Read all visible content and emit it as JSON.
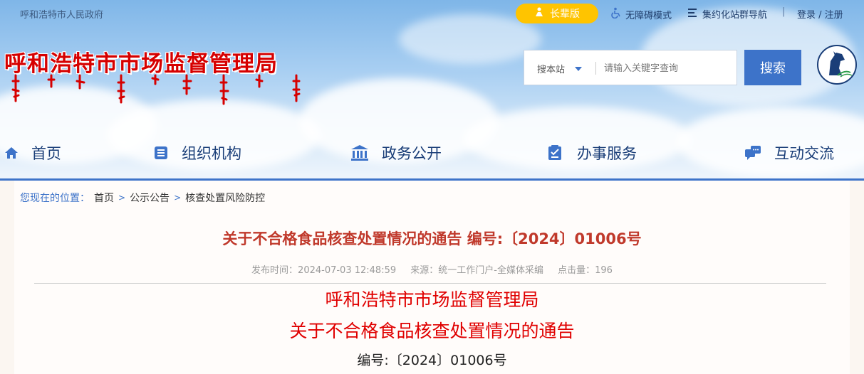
{
  "topbar": {
    "gov_link": "呼和浩特市人民政府",
    "elder_label": "长辈版",
    "accessibility_label": "无障碍模式",
    "sites_label": "集约化站群导航",
    "sep": "|",
    "login_label": "登录 / 注册"
  },
  "header": {
    "site_title": "呼和浩特市市场监督管理局"
  },
  "search": {
    "scope_label": "搜本站",
    "placeholder": "请输入关键字查询",
    "button_label": "搜索"
  },
  "nav": {
    "items": [
      {
        "label": "首页",
        "icon": "home-icon"
      },
      {
        "label": "组织机构",
        "icon": "org-icon"
      },
      {
        "label": "政务公开",
        "icon": "government-building-icon"
      },
      {
        "label": "办事服务",
        "icon": "service-form-icon"
      },
      {
        "label": "互动交流",
        "icon": "chat-icon"
      }
    ]
  },
  "breadcrumb": {
    "label": "您现在的位置：",
    "items": [
      "首页",
      "公示公告",
      "核查处置风险防控"
    ],
    "arrow": ">"
  },
  "article": {
    "title": "关于不合格食品核查处置情况的通告 编号:〔2024〕01006号",
    "publish_time": "发布时间：2024-07-03 12:48:59",
    "source": "来源：统一工作门户-全媒体采编",
    "views": "点击量：196",
    "body_line1": "呼和浩特市市场监督管理局",
    "body_line2": "关于不合格食品核查处置情况的通告",
    "body_number": "编号:〔2024〕01006号"
  },
  "colors": {
    "accent_blue": "#3d73c9",
    "title_red": "#d60000",
    "elder_yellow": "#ffc400"
  }
}
